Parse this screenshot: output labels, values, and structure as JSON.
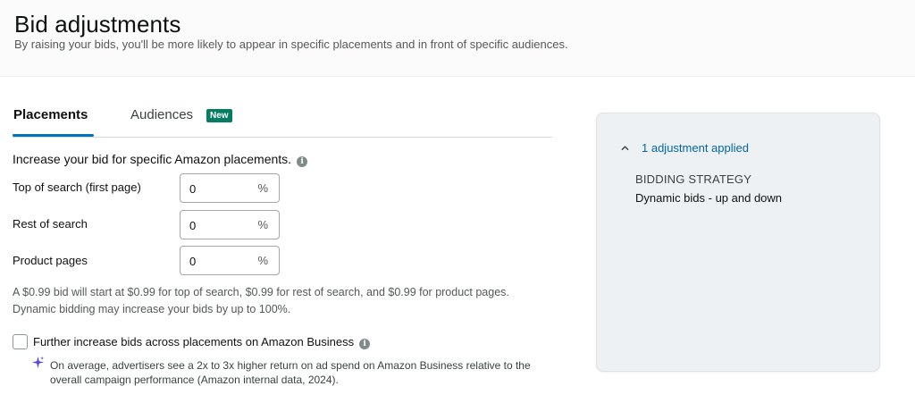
{
  "header": {
    "title": "Bid adjustments",
    "subtitle": "By raising your bids, you'll be more likely to appear in specific placements and in front of specific audiences."
  },
  "tabs": {
    "placements": "Placements",
    "audiences": "Audiences",
    "audiences_badge": "New",
    "active": "Placements"
  },
  "placements": {
    "heading": "Increase your bid for specific Amazon placements.",
    "rows": [
      {
        "label": "Top of search (first page)",
        "value": "0",
        "unit": "%"
      },
      {
        "label": "Rest of search",
        "value": "0",
        "unit": "%"
      },
      {
        "label": "Product pages",
        "value": "0",
        "unit": "%"
      }
    ],
    "note_line1": "A $0.99 bid will start at $0.99 for top of search, $0.99 for rest of search, and $0.99 for product pages.",
    "note_line2": "Dynamic bidding may increase your bids by up to 100%.",
    "business_checkbox": {
      "label": "Further increase bids across placements on Amazon Business",
      "checked": false
    },
    "business_note_line1": "On average, advertisers see a 2x to 3x higher return on ad spend on Amazon Business relative to the",
    "business_note_line2": "overall campaign performance (Amazon internal data, 2024)."
  },
  "summary": {
    "toggle_label": "1 adjustment applied",
    "strategy_heading": "BIDDING STRATEGY",
    "strategy_value": "Dynamic bids - up and down"
  },
  "colors": {
    "accent": "#0073bb",
    "link": "#0066a8",
    "badge": "#067d62",
    "spark": "#5a45d6"
  },
  "icons": [
    "info-icon",
    "sparkle-icon",
    "chevron-up-icon"
  ]
}
